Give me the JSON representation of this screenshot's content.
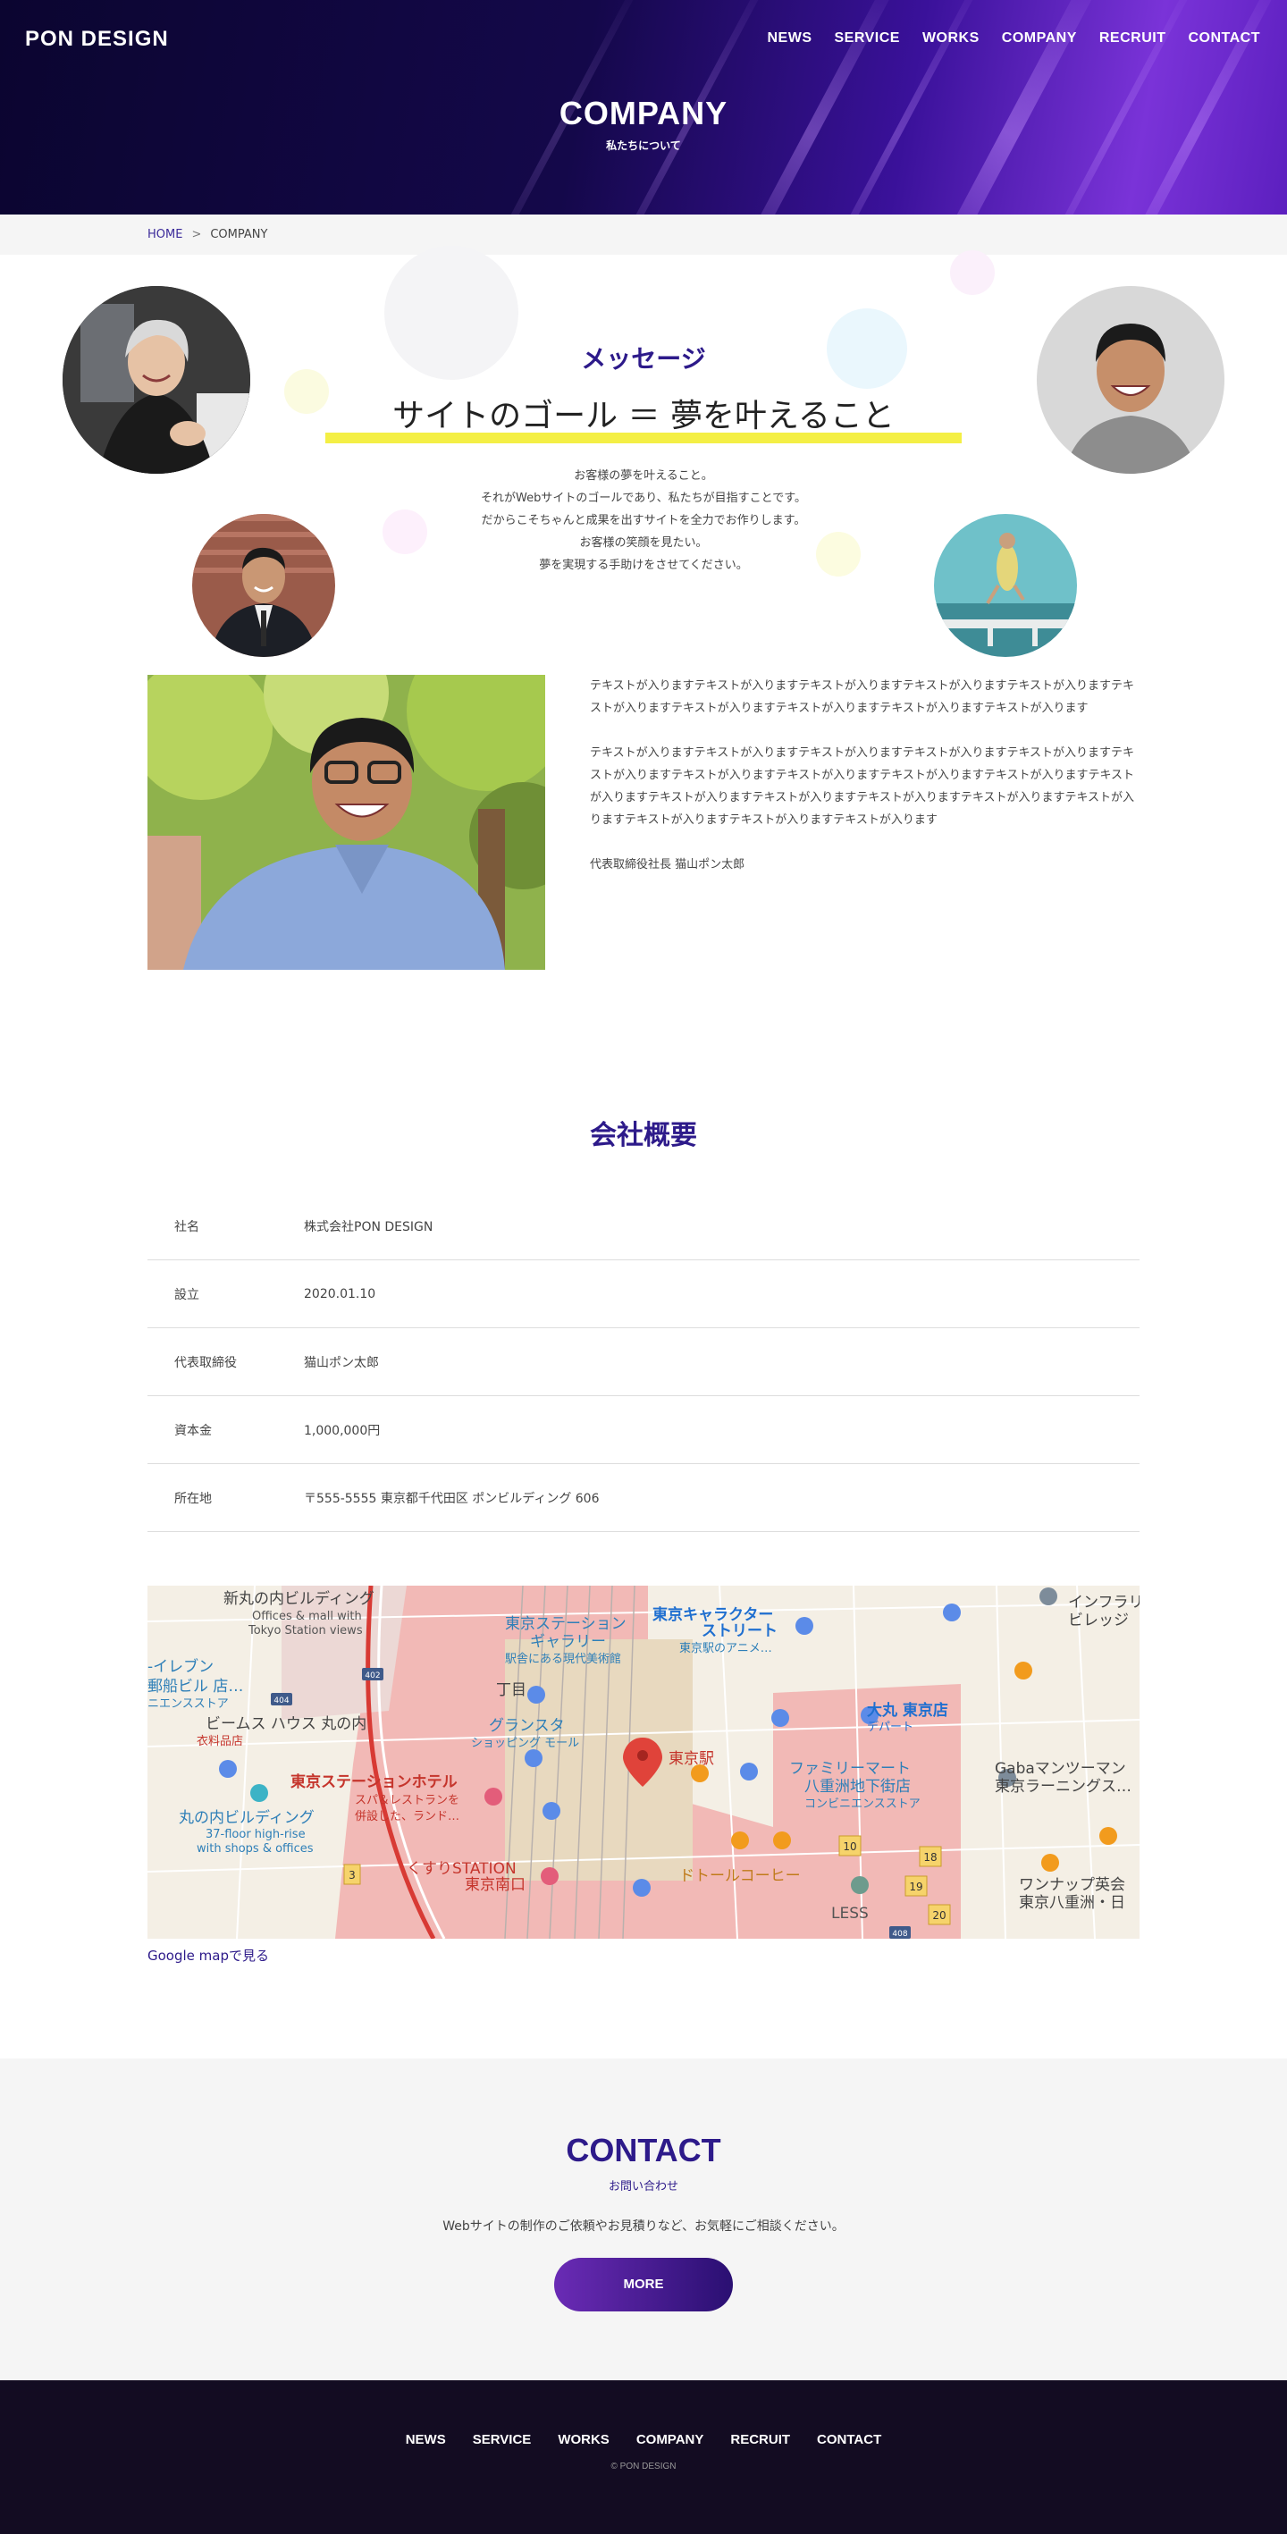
{
  "header": {
    "logo": "PON DESIGN",
    "nav": [
      "NEWS",
      "SERVICE",
      "WORKS",
      "COMPANY",
      "RECRUIT",
      "CONTACT"
    ],
    "page_title": "COMPANY",
    "page_subtitle": "私たちについて"
  },
  "breadcrumb": {
    "home": "HOME",
    "separator": ">",
    "current": "COMPANY"
  },
  "message": {
    "heading": "メッセージ",
    "catch": "サイトのゴール ＝ 夢を叶えること",
    "body": [
      "お客様の夢を叶えること。",
      "それがWebサイトのゴールであり、私たちが目指すことです。",
      "だからこそちゃんと成果を出すサイトを全力でお作りします。",
      "お客様の笑顔を見たい。",
      "夢を実現する手助けをさせてください。"
    ]
  },
  "profile": {
    "paragraph1": "テキストが入りますテキストが入りますテキストが入りますテキストが入りますテキストが入りますテキストが入りますテキストが入りますテキストが入りますテキストが入りますテキストが入ります",
    "paragraph2": "テキストが入りますテキストが入りますテキストが入りますテキストが入りますテキストが入りますテキストが入りますテキストが入りますテキストが入りますテキストが入りますテキストが入りますテキストが入りますテキストが入りますテキストが入りますテキストが入りますテキストが入りますテキストが入りますテキストが入りますテキストが入りますテキストが入ります",
    "signature": "代表取締役社長 猫山ポン太郎"
  },
  "overview": {
    "heading": "会社概要",
    "rows": [
      {
        "label": "社名",
        "value": "株式会社PON DESIGN"
      },
      {
        "label": "設立",
        "value": "2020.01.10"
      },
      {
        "label": "代表取締役",
        "value": "猫山ポン太郎"
      },
      {
        "label": "資本金",
        "value": "1,000,000円"
      },
      {
        "label": "所在地",
        "value": "〒555-5555 東京都千代田区 ポンビルディング 606"
      }
    ]
  },
  "map": {
    "link": "Google mapで見る",
    "labels": {
      "station": "東京駅",
      "shinmarunouchi": "新丸の内ビルディング",
      "shinmarunouchi_en1": "Offices & mall with",
      "shinmarunouchi_en2": "Tokyo Station views",
      "gallery1": "東京ステーション",
      "gallery2": "ギャラリー",
      "gallery3": "駅舎にある現代美術館",
      "character1": "東京キャラクター",
      "character2": "ストリート",
      "character3": "東京駅のアニメ…",
      "gransta1": "グランスタ",
      "gransta2": "ショッピング モール",
      "hotel1": "東京ステーションホテル",
      "hotel2": "スパ＆レストランを",
      "hotel3": "併設した、ランド…",
      "marunouchi1": "丸の内ビルディング",
      "marunouchi2": "37-floor high-rise",
      "marunouchi3": "with shops & offices",
      "beams1": "ビームス ハウス 丸の内",
      "beams2": "衣料品店",
      "daimaru1": "大丸 東京店",
      "daimaru2": "デパート",
      "familymart1": "ファミリーマート",
      "familymart2": "八重洲地下街店",
      "familymart3": "コンビニエンスストア",
      "doutor": "ドトールコーヒー",
      "kusuri1": "くすりSTATION",
      "kusuri2": "東京南口",
      "less": "LESS",
      "gaba1": "Gabaマンツーマン",
      "gaba2": "東京ラーニングス…",
      "onenap1": "ワンナップ英会",
      "onenap2": "東京八重洲・日",
      "seven1": "-イレブン",
      "seven2": "郵船ビル 店…",
      "seven3": "ニエンスストア",
      "yu1": "インフラリー",
      "yu2": "ビレッジ",
      "chome": "丁目",
      "route402": "402",
      "route404": "404",
      "route408": "408",
      "b10": "10",
      "b18": "18",
      "b19": "19",
      "b20": "20",
      "b3": "3"
    }
  },
  "contact": {
    "heading": "CONTACT",
    "subheading": "お問い合わせ",
    "description": "Webサイトの制作のご依頼やお見積りなど、お気軽にご相談ください。",
    "button": "MORE"
  },
  "footer": {
    "nav": [
      "NEWS",
      "SERVICE",
      "WORKS",
      "COMPANY",
      "RECRUIT",
      "CONTACT"
    ],
    "copyright": "© PON DESIGN"
  },
  "colors": {
    "accent": "#2d1a8a",
    "highlight": "#f4ef45",
    "footer_bg": "#130c22"
  }
}
